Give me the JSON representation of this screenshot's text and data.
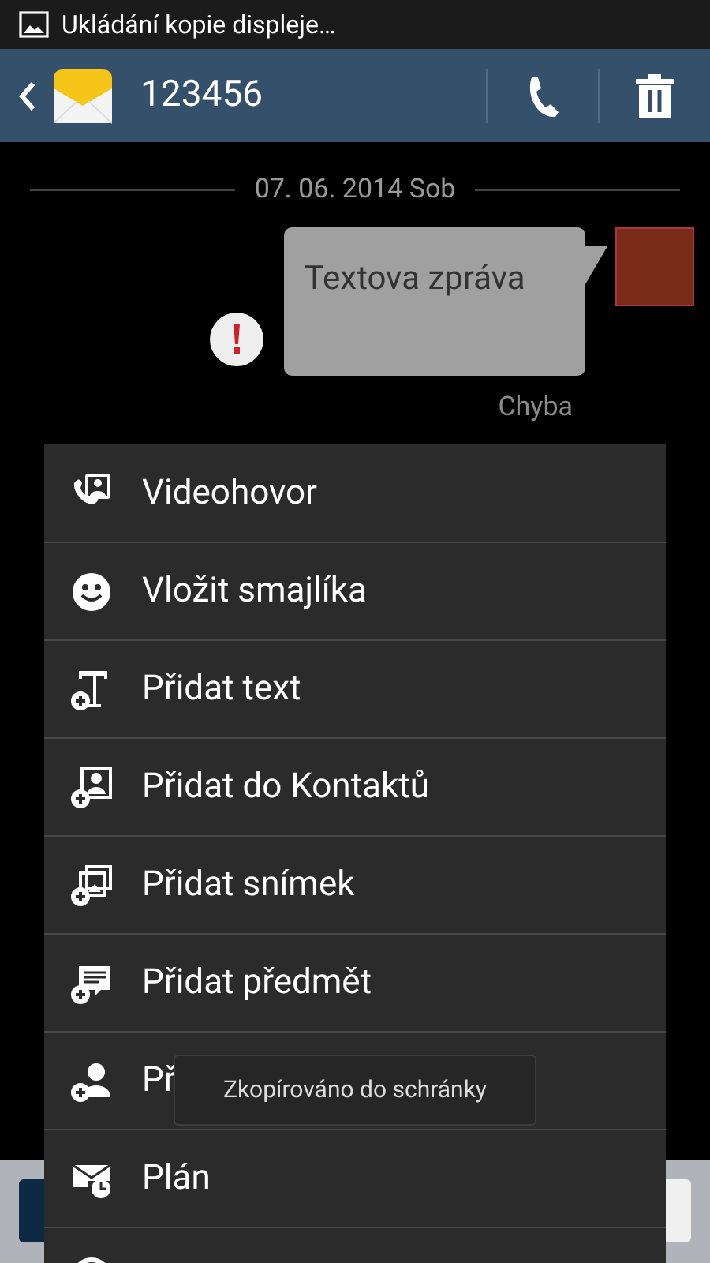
{
  "status_bar": {
    "notification": "Ukládání kopie displeje…"
  },
  "header": {
    "title": "123456"
  },
  "conversation": {
    "date": "07. 06. 2014 Sob",
    "message": {
      "text": "Textova zpráva",
      "status": "Chyba",
      "failed": true
    }
  },
  "menu": {
    "items": [
      {
        "label": "Videohovor",
        "kind": "video"
      },
      {
        "label": "Vložit smajlíka",
        "kind": "smiley"
      },
      {
        "label": "Přidat text",
        "kind": "text"
      },
      {
        "label": "Přidat do Kontaktů",
        "kind": "contact"
      },
      {
        "label": "Přidat snímek",
        "kind": "slide"
      },
      {
        "label": "Přidat předmět",
        "kind": "subject"
      },
      {
        "label": "Př",
        "kind": "person"
      },
      {
        "label": "Plán",
        "kind": "schedule"
      },
      {
        "kind": "round"
      }
    ]
  },
  "toast": {
    "text": "Zkopírováno do schránky"
  }
}
